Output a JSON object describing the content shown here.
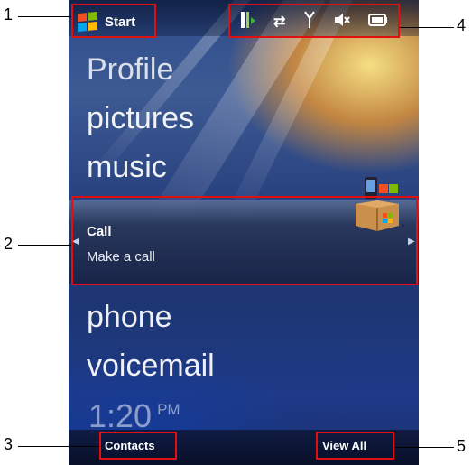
{
  "callouts": [
    "1",
    "2",
    "3",
    "4",
    "5"
  ],
  "status_bar": {
    "start_label": "Start",
    "icons": [
      "data-connection-icon",
      "sync-arrows-icon",
      "signal-antenna-icon",
      "speaker-muted-icon",
      "battery-icon"
    ]
  },
  "menu": {
    "items": [
      "Profile",
      "pictures",
      "music"
    ],
    "selected": {
      "title": "Call",
      "subtitle": "Make a call"
    },
    "items_below": [
      "phone",
      "voicemail"
    ]
  },
  "clock": {
    "time": "1:20",
    "ampm": "PM"
  },
  "softkeys": {
    "left": "Contacts",
    "right": "View All"
  },
  "colors": {
    "highlight_box": "#e01010",
    "text": "#ffffff"
  }
}
